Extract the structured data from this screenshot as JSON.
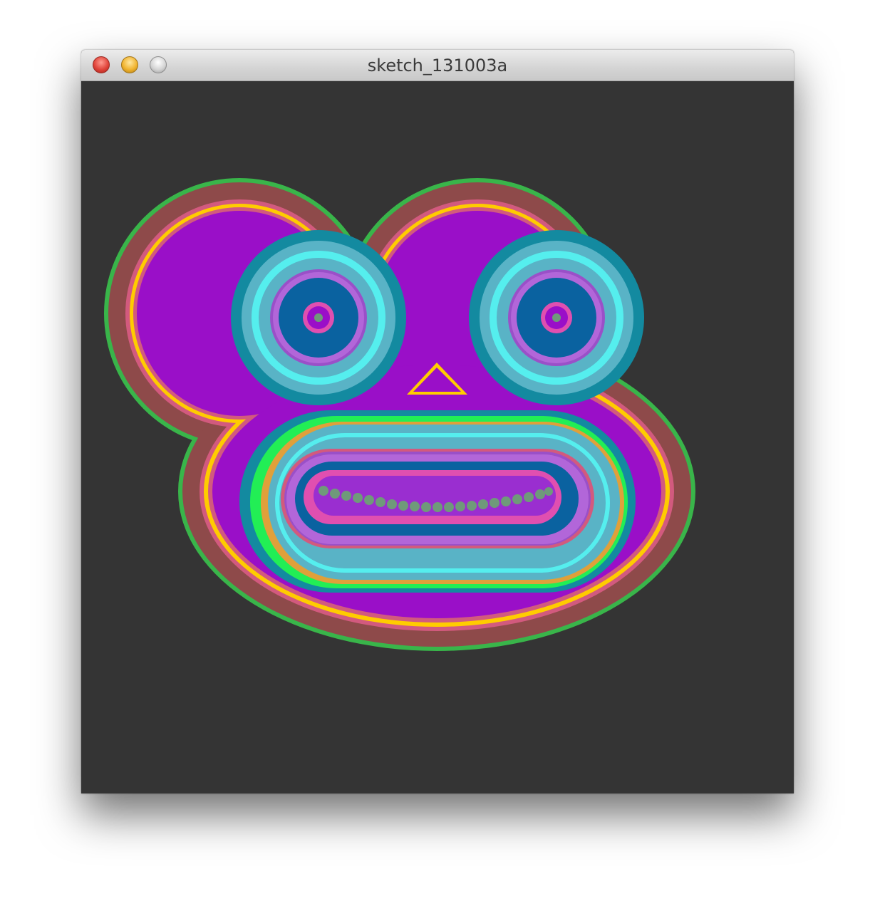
{
  "window": {
    "title": "sketch_131003a",
    "background": "#343434"
  },
  "controls": {
    "close": "close-button",
    "minimize": "minimize-button",
    "zoom": "zoom-button"
  },
  "sketch": {
    "description_colors": [
      "#33bb44",
      "#8e4a4a",
      "#d25a7e",
      "#ffcc00",
      "#9a0fc8",
      "#138aa0",
      "#59b3c6",
      "#55eeee",
      "#0a62a0",
      "#b266d9",
      "#e04fb0",
      "#6f9a7a"
    ]
  }
}
